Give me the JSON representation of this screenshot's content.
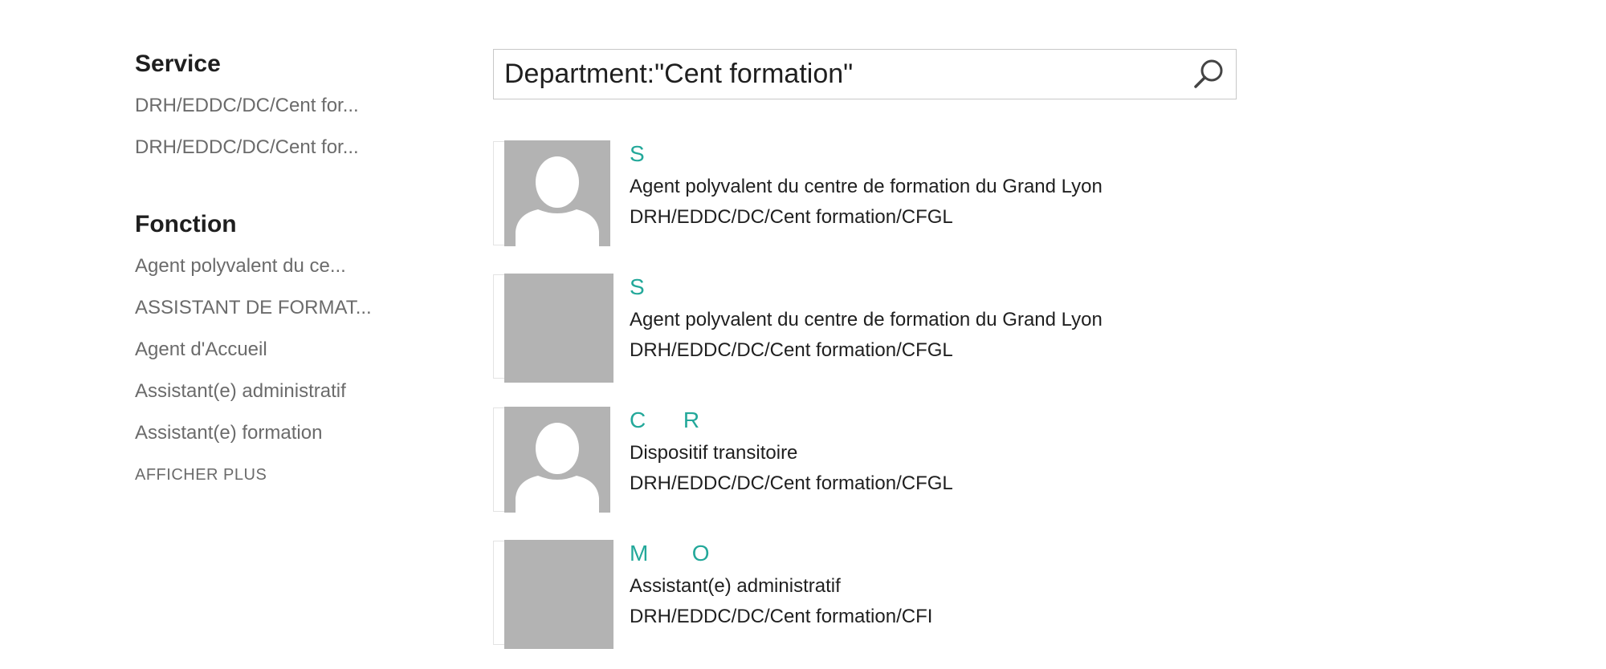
{
  "refiners": {
    "service": {
      "heading": "Service",
      "items": [
        "DRH/EDDC/DC/Cent for...",
        "DRH/EDDC/DC/Cent for..."
      ]
    },
    "fonction": {
      "heading": "Fonction",
      "items": [
        "Agent polyvalent du ce...",
        "ASSISTANT DE FORMAT...",
        "Agent d'Accueil",
        "Assistant(e) administratif",
        "Assistant(e) formation"
      ],
      "more_label": "AFFICHER PLUS"
    }
  },
  "search": {
    "value": "Department:\"Cent formation\"",
    "icon": "search-icon"
  },
  "results": [
    {
      "name": "S",
      "title": "Agent polyvalent du centre de formation du Grand Lyon",
      "department": "DRH/EDDC/DC/Cent formation/CFGL",
      "photo": "person-silhouette-icon"
    },
    {
      "name": "S",
      "title": "Agent polyvalent du centre de formation du Grand Lyon",
      "department": "DRH/EDDC/DC/Cent formation/CFGL",
      "photo": "gray-placeholder"
    },
    {
      "name": "C      R",
      "title": "Dispositif transitoire",
      "department": "DRH/EDDC/DC/Cent formation/CFGL",
      "photo": "person-silhouette-icon"
    },
    {
      "name": "M       O",
      "title": "Assistant(e) administratif",
      "department": "DRH/EDDC/DC/Cent formation/CFI",
      "photo": "gray-placeholder"
    }
  ],
  "colors": {
    "name_link": "#23a89a",
    "refiner_text": "#6b6b6b",
    "photo_gray": "#b3b3b3"
  }
}
